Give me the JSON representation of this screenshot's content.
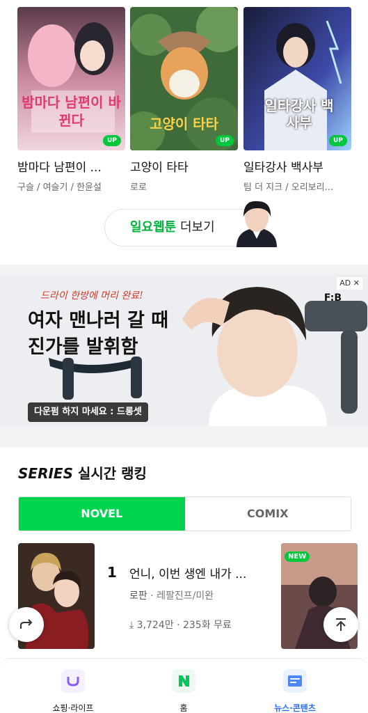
{
  "webtoons": [
    {
      "title": "밤마다 남편이 ...",
      "authors": "구슬 / 여슬기 / 한윤설",
      "badge": "UP",
      "cover_text": "밤마다 남편이 바뀐다"
    },
    {
      "title": "고양이 타타",
      "authors": "로로",
      "badge": "UP",
      "cover_text": "고양이 타타"
    },
    {
      "title": "일타강사 백사부",
      "authors": "팀 더 지크 / 오리보리...",
      "badge": "UP",
      "cover_text": "일타강사 백사부"
    }
  ],
  "more_button": {
    "highlight": "일요웹툰",
    "label": "더보기"
  },
  "ad": {
    "small": "드라이 한방에 머리 완료!",
    "headline1": "여자 맨나러 갈 때",
    "headline2": "진가를 발휘함",
    "pill": "다운펌 하지 마세요 : 드롱셋",
    "badge": "AD ✕",
    "brand": "F:B"
  },
  "series": {
    "logo": "SERIES",
    "title": "실시간 랭킹",
    "tabs": [
      "NOVEL",
      "COMIX"
    ],
    "active_tab": "NOVEL",
    "item": {
      "rank": "1",
      "title": "언니, 이번 생엔 내가 ...",
      "genre": "로판",
      "author": "레팔진프/미완",
      "downloads": "3,724만",
      "episodes": "235화 무료"
    },
    "next_badge": "NEW"
  },
  "nav": [
    {
      "label": "쇼핑·라이프",
      "icon": "shopping-icon"
    },
    {
      "label": "홈",
      "icon": "naver-home-icon"
    },
    {
      "label": "뉴스·콘텐츠",
      "icon": "news-icon",
      "active": true
    }
  ],
  "colors": {
    "green": "#00c73c",
    "tab_green": "#00d44f",
    "nav_active": "#2b6df0"
  }
}
